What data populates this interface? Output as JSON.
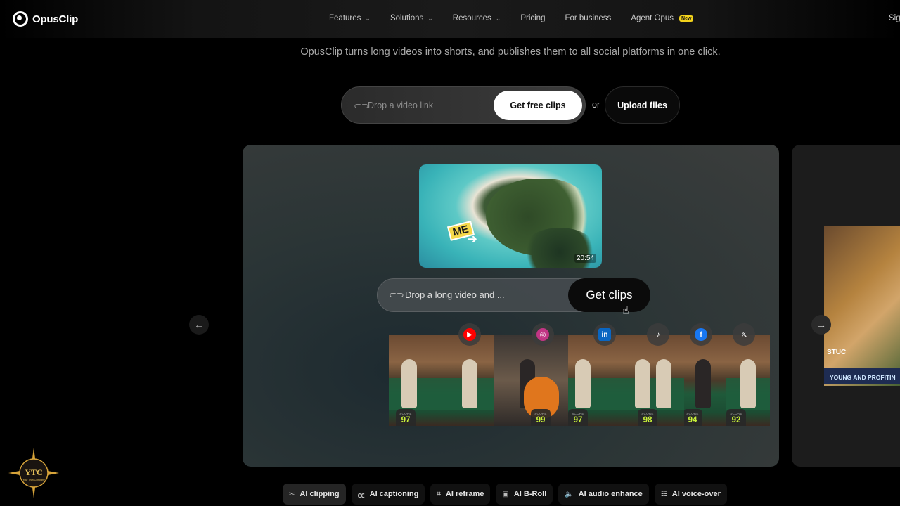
{
  "nav": {
    "logo": "OpusClip",
    "items": [
      {
        "label": "Features",
        "has_dropdown": true
      },
      {
        "label": "Solutions",
        "has_dropdown": true
      },
      {
        "label": "Resources",
        "has_dropdown": true
      },
      {
        "label": "Pricing",
        "has_dropdown": false
      },
      {
        "label": "For business",
        "has_dropdown": false
      },
      {
        "label": "Agent Opus",
        "has_dropdown": false,
        "badge": "New"
      }
    ],
    "sign": "Sig"
  },
  "tagline": "OpusClip turns long videos into shorts, and publishes them to all social platforms in one click.",
  "hero": {
    "input_placeholder": "Drop a video link",
    "cta": "Get free clips",
    "or": "or",
    "upload": "Upload files"
  },
  "demo": {
    "duration": "20:54",
    "thumb_tag": "ME",
    "input_text": "Drop a long video and ...",
    "cta": "Get clips",
    "score_label": "SCORE",
    "scores": [
      "97",
      "99",
      "97",
      "98",
      "94",
      "92"
    ],
    "socials": [
      {
        "name": "youtube-icon",
        "glyph": "▶",
        "color": "#ff0000"
      },
      {
        "name": "instagram-icon",
        "glyph": "◎",
        "color": "#c13584"
      },
      {
        "name": "linkedin-icon",
        "glyph": "in",
        "color": "#0a66c2"
      },
      {
        "name": "tiktok-icon",
        "glyph": "♪",
        "color": "#111111"
      },
      {
        "name": "facebook-icon",
        "glyph": "f",
        "color": "#1877f2"
      },
      {
        "name": "x-icon",
        "glyph": "𝕏",
        "color": "#333333"
      }
    ]
  },
  "side_card": {
    "text1": "STUC",
    "text2": "YOUNG AND PROFITIN"
  },
  "tabs": [
    {
      "label": "AI clipping",
      "icon": "scissors-icon",
      "glyph": "✂",
      "active": true
    },
    {
      "label": "AI captioning",
      "icon": "cc-icon",
      "glyph": "㏄",
      "active": false
    },
    {
      "label": "AI reframe",
      "icon": "crop-icon",
      "glyph": "⌗",
      "active": false
    },
    {
      "label": "AI B-Roll",
      "icon": "broll-icon",
      "glyph": "▣",
      "active": false
    },
    {
      "label": "AI audio enhance",
      "icon": "speaker-icon",
      "glyph": "🔈",
      "active": false
    },
    {
      "label": "AI voice-over",
      "icon": "voice-icon",
      "glyph": "☷",
      "active": false
    }
  ],
  "watermark": {
    "text": "YTC",
    "sub": "Your Tech Company"
  },
  "colors": {
    "accent_score": "#c8f03a",
    "badge_new": "#f2d21b"
  }
}
